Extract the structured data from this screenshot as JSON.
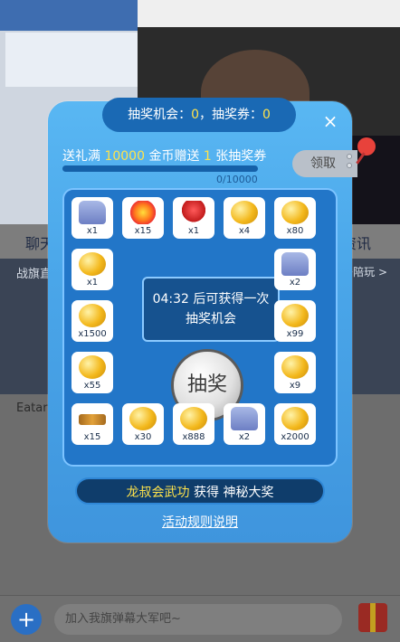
{
  "background": {
    "tab_left": "聊天",
    "tab_right": "资讯",
    "banner_left": "战旗直",
    "banner_right": "多陪玩 >",
    "list_item": "Eatar",
    "input_placeholder": "加入我旗弹幕大军吧~",
    "plus_label": "+"
  },
  "modal": {
    "chance_prefix": "抽奖机会：",
    "chance_count": "0",
    "ticket_prefix": "，抽奖券：",
    "ticket_count": "0",
    "close_label": "×",
    "reward_prefix": "送礼满 ",
    "reward_amount": "10000",
    "reward_mid": " 金币赠送 ",
    "reward_tickets": "1",
    "reward_suffix": " 张抽奖券",
    "progress_label": "0/10000",
    "progress_fraction": 0.0,
    "claim_label": "领取",
    "center_line1": "04:32 后可获得一次",
    "center_line2": "抽奖机会",
    "draw_label": "抽奖",
    "winner_name": "龙叔会武功",
    "winner_text": " 获得 神秘大奖",
    "rules_label": "活动规则说明"
  },
  "prizes": [
    {
      "icon": "skate-icon",
      "count": "x1"
    },
    {
      "icon": "firework-icon",
      "count": "x15"
    },
    {
      "icon": "flower-icon",
      "count": "x1"
    },
    {
      "icon": "coin-icon",
      "count": "x4"
    },
    {
      "icon": "coin-icon",
      "count": "x80"
    },
    {
      "icon": "coin-icon",
      "count": "x1"
    },
    {
      "icon": "skate-icon",
      "count": "x2"
    },
    {
      "icon": "coin-icon",
      "count": "x1500"
    },
    {
      "icon": "coin-icon",
      "count": "x99"
    },
    {
      "icon": "coin-icon",
      "count": "x55"
    },
    {
      "icon": "coin-icon",
      "count": "x9"
    },
    {
      "icon": "belt-icon",
      "count": "x15"
    },
    {
      "icon": "coin-icon",
      "count": "x30"
    },
    {
      "icon": "coin-icon",
      "count": "x888"
    },
    {
      "icon": "skate-icon",
      "count": "x2"
    },
    {
      "icon": "coin-icon",
      "count": "x2000"
    }
  ]
}
